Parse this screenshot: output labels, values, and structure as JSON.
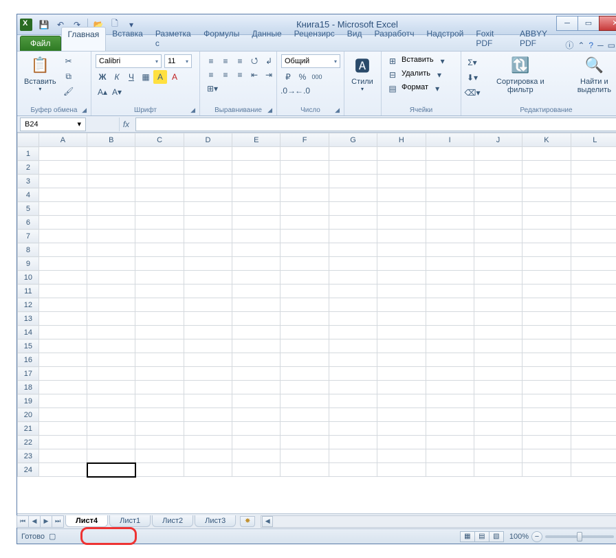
{
  "title": "Книга15 - Microsoft Excel",
  "qat": {
    "save": "💾",
    "undo": "↶",
    "redo": "↷",
    "open": "📂",
    "new": "🗋"
  },
  "tabs": {
    "file": "Файл",
    "items": [
      "Главная",
      "Вставка",
      "Разметка с",
      "Формулы",
      "Данные",
      "Рецензирс",
      "Вид",
      "Разработч",
      "Надстрой",
      "Foxit PDF",
      "ABBYY PDF"
    ],
    "active": 0
  },
  "ribbon": {
    "clipboard": {
      "paste": "Вставить",
      "label": "Буфер обмена"
    },
    "font": {
      "name": "Calibri",
      "size": "11",
      "label": "Шрифт"
    },
    "align": {
      "label": "Выравнивание"
    },
    "number": {
      "format": "Общий",
      "label": "Число",
      "percent": "%",
      "comma": "000"
    },
    "styles": {
      "btn": "Стили"
    },
    "cells": {
      "insert": "Вставить",
      "delete": "Удалить",
      "format": "Формат",
      "label": "Ячейки"
    },
    "editing": {
      "sort": "Сортировка и фильтр",
      "find": "Найти и выделить",
      "label": "Редактирование"
    }
  },
  "namebox": "B24",
  "fx": "fx",
  "columns": [
    "A",
    "B",
    "C",
    "D",
    "E",
    "F",
    "G",
    "H",
    "I",
    "J",
    "K",
    "L"
  ],
  "rows": [
    "1",
    "2",
    "3",
    "4",
    "5",
    "6",
    "7",
    "8",
    "9",
    "10",
    "11",
    "12",
    "13",
    "14",
    "15",
    "16",
    "17",
    "18",
    "19",
    "20",
    "21",
    "22",
    "23",
    "24"
  ],
  "activeCell": {
    "row": 23,
    "col": 1
  },
  "selectedCol": 1,
  "selectedRow": 23,
  "sheets": {
    "active": "Лист4",
    "others": [
      "Лист1",
      "Лист2",
      "Лист3"
    ]
  },
  "status": {
    "ready": "Готово",
    "zoom": "100%"
  }
}
